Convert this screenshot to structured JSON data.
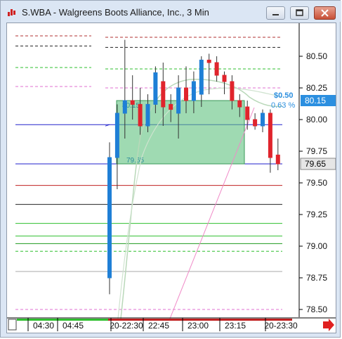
{
  "window": {
    "title": "S.WBA - Walgreens Boots Alliance, Inc., 3 Min",
    "minimize_icon": "minimize-icon",
    "maximize_icon": "maximize-icon",
    "close_icon": "close-icon"
  },
  "chart": {
    "price_axis_ticks": [
      "80.50",
      "80.25",
      "80.00",
      "79.75",
      "79.50",
      "79.25",
      "79.00",
      "78.75",
      "78.50"
    ],
    "time_axis_ticks": [
      "04:30",
      "04:45",
      "20-22:30",
      "22:45",
      "23:00",
      "23:15",
      "20-23:30"
    ],
    "last_price_label": "79.65",
    "level_price_label": "80.15",
    "measure_change": "$0.50",
    "measure_percent": "0.63 %",
    "box_top_label": "80.15",
    "box_bottom_label": "79.65",
    "scroll_arrow_icon": "right-arrow-icon",
    "colors": {
      "up_candle": "#1f7fd6",
      "down_candle": "#e0242c",
      "box_fill": "#5fc27e",
      "blue_line": "#2222cc"
    }
  },
  "chart_data": {
    "type": "candlestick",
    "title": "S.WBA - Walgreens Boots Alliance, Inc., 3 Min",
    "xlabel": "",
    "ylabel": "",
    "ylim": [
      78.45,
      80.7
    ],
    "x_ticks": [
      "04:30",
      "04:45",
      "20-22:30",
      "22:45",
      "23:00",
      "23:15",
      "20-23:30"
    ],
    "y_ticks": [
      80.5,
      80.25,
      80.0,
      79.75,
      79.5,
      79.25,
      79.0,
      78.75,
      78.5
    ],
    "candles": [
      {
        "o": 78.75,
        "h": 79.82,
        "l": 78.62,
        "c": 79.7
      },
      {
        "o": 79.7,
        "h": 80.12,
        "l": 79.45,
        "c": 80.05
      },
      {
        "o": 80.05,
        "h": 80.63,
        "l": 79.85,
        "c": 80.15
      },
      {
        "o": 80.15,
        "h": 80.35,
        "l": 80.0,
        "c": 80.12
      },
      {
        "o": 80.12,
        "h": 80.25,
        "l": 79.88,
        "c": 79.95
      },
      {
        "o": 79.95,
        "h": 80.2,
        "l": 79.9,
        "c": 80.12
      },
      {
        "o": 80.12,
        "h": 80.42,
        "l": 80.05,
        "c": 80.37
      },
      {
        "o": 80.3,
        "h": 80.45,
        "l": 79.95,
        "c": 80.1
      },
      {
        "o": 80.12,
        "h": 80.2,
        "l": 79.98,
        "c": 80.08
      },
      {
        "o": 80.05,
        "h": 80.35,
        "l": 79.85,
        "c": 80.25
      },
      {
        "o": 80.25,
        "h": 80.42,
        "l": 80.05,
        "c": 80.15
      },
      {
        "o": 80.15,
        "h": 80.38,
        "l": 80.05,
        "c": 80.3
      },
      {
        "o": 80.2,
        "h": 80.5,
        "l": 80.1,
        "c": 80.47
      },
      {
        "o": 80.47,
        "h": 80.52,
        "l": 80.2,
        "c": 80.45
      },
      {
        "o": 80.45,
        "h": 80.5,
        "l": 80.3,
        "c": 80.35
      },
      {
        "o": 80.35,
        "h": 80.38,
        "l": 80.2,
        "c": 80.3
      },
      {
        "o": 80.3,
        "h": 80.35,
        "l": 80.08,
        "c": 80.15
      },
      {
        "o": 80.15,
        "h": 80.2,
        "l": 80.02,
        "c": 80.1
      },
      {
        "o": 80.1,
        "h": 80.15,
        "l": 79.92,
        "c": 80.0
      },
      {
        "o": 80.0,
        "h": 80.05,
        "l": 79.92,
        "c": 79.95
      },
      {
        "o": 79.95,
        "h": 80.08,
        "l": 79.9,
        "c": 80.05
      },
      {
        "o": 80.05,
        "h": 80.08,
        "l": 79.58,
        "c": 79.7
      },
      {
        "o": 79.72,
        "h": 79.85,
        "l": 79.6,
        "c": 79.65
      }
    ],
    "horizontal_levels": [
      {
        "price": 80.65,
        "color": "#b03030",
        "style": "dashed"
      },
      {
        "price": 80.57,
        "color": "#222222",
        "style": "dashed"
      },
      {
        "price": 80.4,
        "color": "#2fbf2f",
        "style": "dashed"
      },
      {
        "price": 80.25,
        "color": "#e070d0",
        "style": "dashed"
      },
      {
        "price": 79.96,
        "color": "#2222cc",
        "style": "solid"
      },
      {
        "price": 79.65,
        "color": "#2222cc",
        "style": "solid"
      },
      {
        "price": 79.48,
        "color": "#c02020",
        "style": "solid"
      },
      {
        "price": 79.33,
        "color": "#222222",
        "style": "solid"
      },
      {
        "price": 79.18,
        "color": "#2fbf2f",
        "style": "solid"
      },
      {
        "price": 79.08,
        "color": "#2fbf2f",
        "style": "solid"
      },
      {
        "price": 79.02,
        "color": "#1e9a1e",
        "style": "solid"
      },
      {
        "price": 78.96,
        "color": "#2fbf2f",
        "style": "dashed"
      },
      {
        "price": 78.8,
        "color": "#aaaaaa",
        "style": "solid"
      },
      {
        "price": 78.5,
        "color": "#e070d0",
        "style": "dashed"
      }
    ],
    "measure_box": {
      "top": 80.15,
      "bottom": 79.65,
      "change": 0.5,
      "percent": 0.63
    },
    "last_price": 79.65,
    "level_label": 80.15
  }
}
